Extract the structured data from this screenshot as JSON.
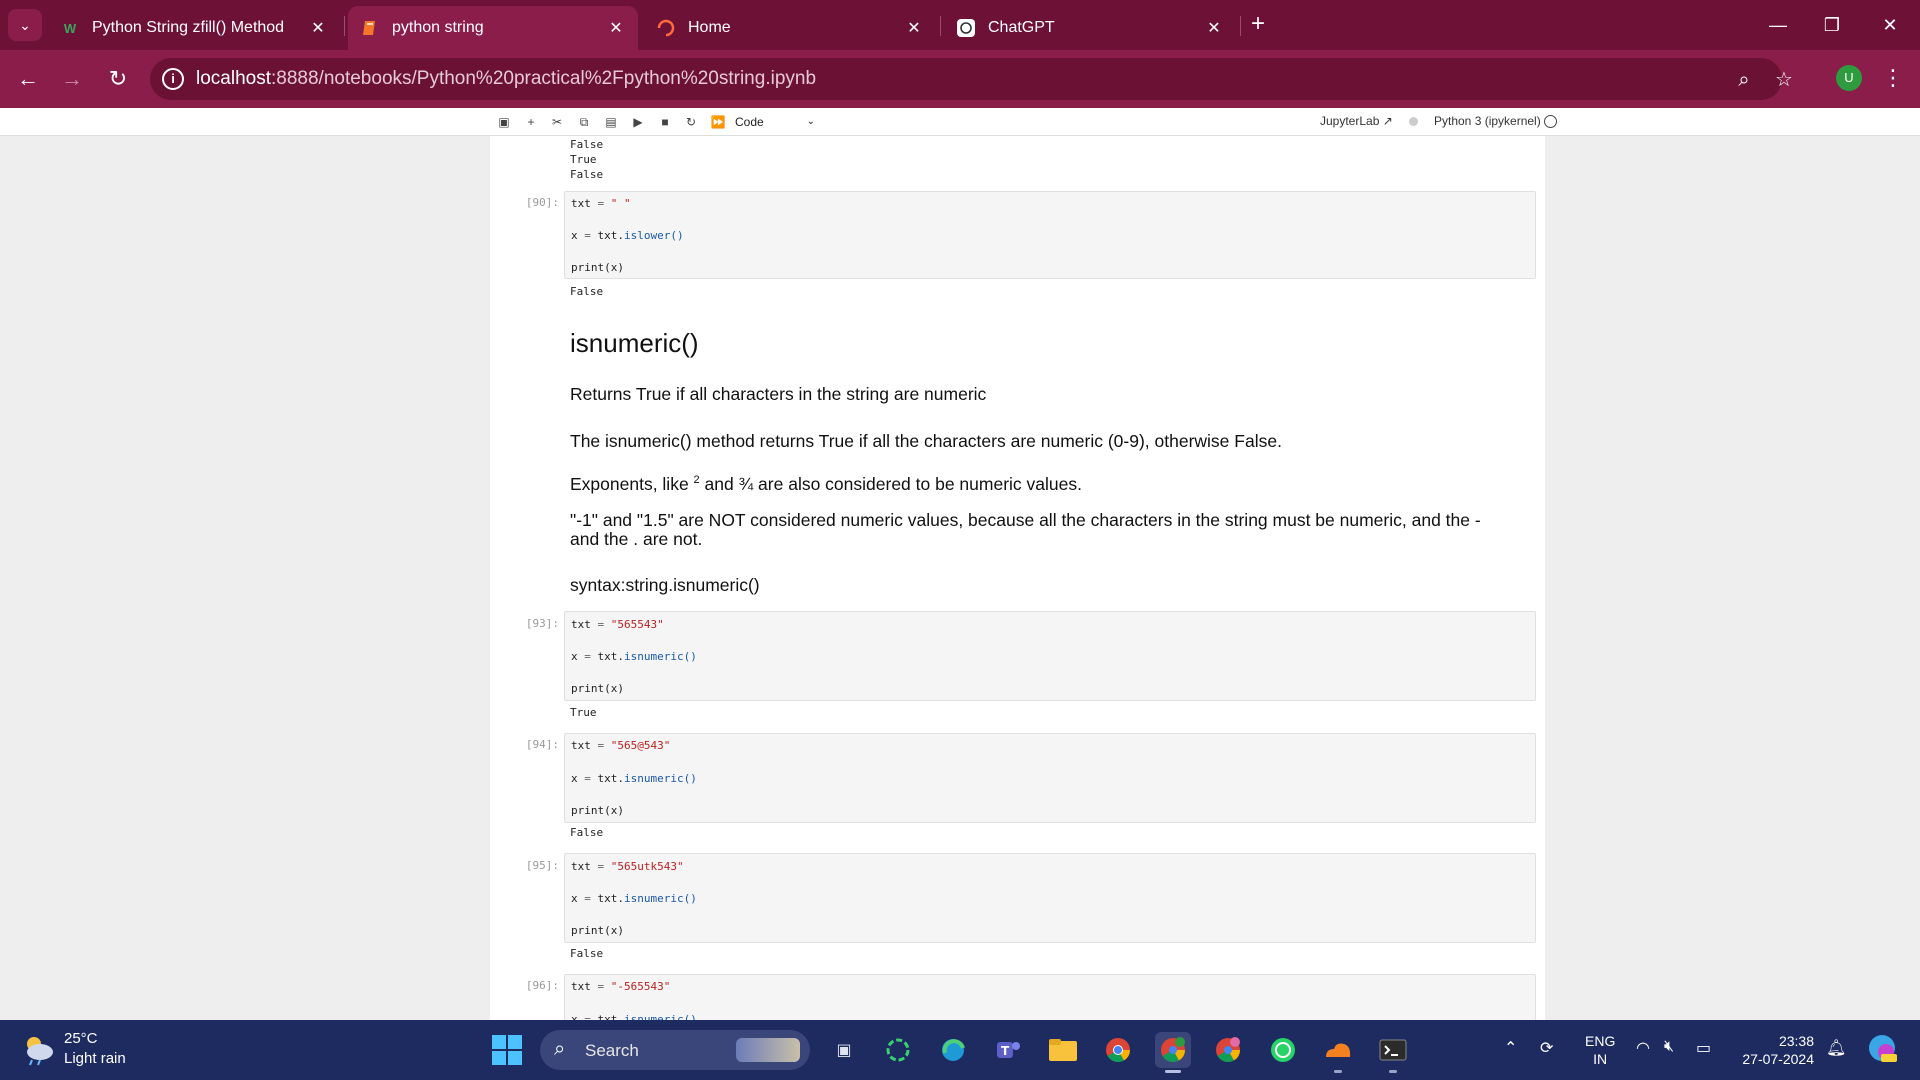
{
  "browser": {
    "tabs": [
      {
        "title": "Python String zfill() Method",
        "favicon": "W",
        "active": false
      },
      {
        "title": "python string",
        "favicon": "jupyter-icon",
        "active": true
      },
      {
        "title": "Home",
        "favicon": "loading-icon",
        "active": false
      },
      {
        "title": "ChatGPT",
        "favicon": "chatgpt-icon",
        "active": false
      }
    ],
    "url_host": "localhost",
    "url_path": ":8888/notebooks/Python%20practical%2Fpython%20string.ipynb",
    "profile_initial": "U"
  },
  "jupyter_toolbar": {
    "cell_type": "Code",
    "jupyterlab_label": "JupyterLab",
    "kernel": "Python 3 (ipykernel)"
  },
  "notebook": {
    "top_outputs": [
      "False",
      "True",
      "False"
    ],
    "cells": [
      {
        "prompt": "[90]:",
        "lines": [
          [
            "txt ",
            "= ",
            "\" \""
          ],
          [
            "x ",
            "= ",
            "txt.",
            "islower()"
          ],
          [
            "print(x)"
          ]
        ],
        "output": "False"
      },
      {
        "prompt": "[93]:",
        "lines": [
          [
            "txt ",
            "= ",
            "\"565543\""
          ],
          [
            "x ",
            "= ",
            "txt.",
            "isnumeric()"
          ],
          [
            "print(x)"
          ]
        ],
        "output": "True"
      },
      {
        "prompt": "[94]:",
        "lines": [
          [
            "txt ",
            "= ",
            "\"565@543\""
          ],
          [
            "x ",
            "= ",
            "txt.",
            "isnumeric()"
          ],
          [
            "print(x)"
          ]
        ],
        "output": "False"
      },
      {
        "prompt": "[95]:",
        "lines": [
          [
            "txt ",
            "= ",
            "\"565utk543\""
          ],
          [
            "x ",
            "= ",
            "txt.",
            "isnumeric()"
          ],
          [
            "print(x)"
          ]
        ],
        "output": "False"
      },
      {
        "prompt": "[96]:",
        "lines": [
          [
            "txt ",
            "= ",
            "\"-565543\""
          ],
          [
            "x ",
            "= ",
            "txt.",
            "isnumeric()"
          ]
        ],
        "output": ""
      }
    ],
    "markdown": {
      "heading": "isnumeric()",
      "p1": "Returns True if all characters in the string are numeric",
      "p2": "The isnumeric() method returns True if all the characters are numeric (0-9), otherwise False.",
      "p3_before": "Exponents, like ",
      "p3_sup": "2",
      "p3_after": " and ¾ are also considered to be numeric values.",
      "p4": "\"-1\" and \"1.5\" are NOT considered numeric values, because all the characters in the string must be numeric, and the - and the . are not.",
      "p5": "syntax:string.isnumeric()"
    }
  },
  "taskbar": {
    "weather_temp": "25°C",
    "weather_desc": "Light rain",
    "search_label": "Search",
    "lang_top": "ENG",
    "lang_bottom": "IN",
    "time": "23:38",
    "date": "27-07-2024"
  },
  "colors": {
    "tabbar": "#6e1137",
    "navbar": "#8a1d4a",
    "taskbar": "#1d2b60",
    "string_literal": "#ba2121",
    "method": "#1a59a5"
  }
}
